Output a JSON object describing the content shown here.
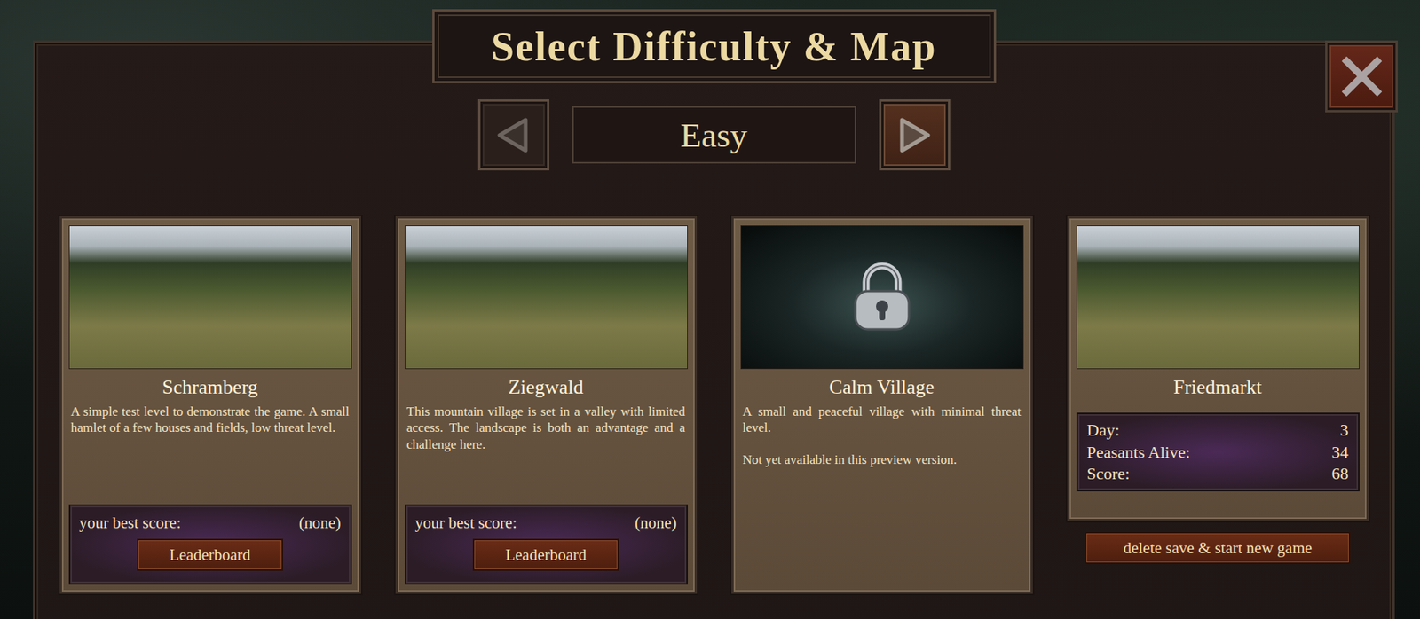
{
  "window": {
    "title": "Select Difficulty & Map"
  },
  "difficulty": {
    "label": "Easy",
    "prev": {
      "disabled": true
    },
    "next": {
      "disabled": false
    }
  },
  "maps": [
    {
      "name": "Schramberg",
      "kind": "score",
      "locked": false,
      "description": [
        "A simple test level to demonstrate the game. A small hamlet of a few houses and fields, low threat level."
      ],
      "best_score_label": "your best score:",
      "best_score": "(none)",
      "button": "Leaderboard"
    },
    {
      "name": "Ziegwald",
      "kind": "score",
      "locked": false,
      "description": [
        "This mountain village is set in a valley with limited access. The landscape is both an advantage and a challenge here."
      ],
      "best_score_label": "your best score:",
      "best_score": "(none)",
      "button": "Leaderboard"
    },
    {
      "name": "Calm Village",
      "kind": "locked",
      "locked": true,
      "description": [
        "A small and peaceful village with minimal threat level.",
        "Not yet available in this preview version."
      ]
    },
    {
      "name": "Friedmarkt",
      "kind": "save",
      "locked": false,
      "description": [],
      "stats": [
        {
          "label": "Day:",
          "value": "3"
        },
        {
          "label": "Peasants Alive:",
          "value": "34"
        },
        {
          "label": "Score:",
          "value": "68"
        }
      ],
      "button": "delete save & start new game"
    }
  ]
}
